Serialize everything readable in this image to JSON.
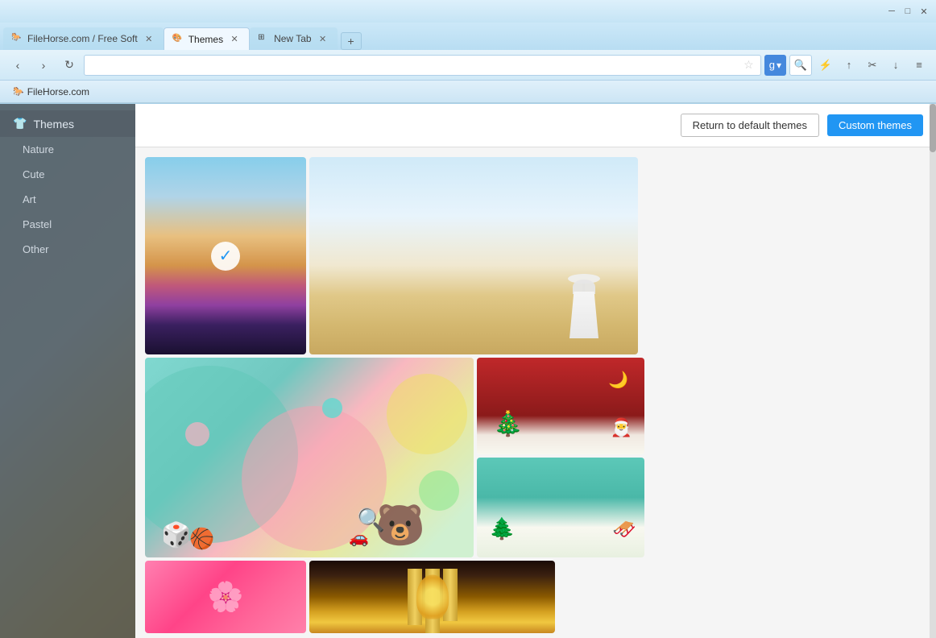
{
  "browser": {
    "title": "Themes",
    "tabs": [
      {
        "id": "tab1",
        "label": "FileHorse.com / Free Soft",
        "favicon": "🐎",
        "active": false
      },
      {
        "id": "tab2",
        "label": "Themes",
        "favicon": "🎨",
        "active": true
      },
      {
        "id": "tab3",
        "label": "New Tab",
        "favicon": "⊞",
        "active": false
      }
    ],
    "address": "",
    "bookmark_site": "FileHorse.com",
    "bookmark_favicon": "🐎"
  },
  "toolbar_buttons": {
    "back": "‹",
    "forward": "›",
    "reload": "↻",
    "star": "☆",
    "new_tab": "+",
    "menu": "≡"
  },
  "themes_page": {
    "header_btn_default": "Return to default themes",
    "header_btn_custom": "Custom themes",
    "sidebar_title": "Themes",
    "sidebar_icon": "👕",
    "categories": [
      {
        "label": "Nature"
      },
      {
        "label": "Cute"
      },
      {
        "label": "Art"
      },
      {
        "label": "Pastel"
      },
      {
        "label": "Other"
      }
    ]
  }
}
